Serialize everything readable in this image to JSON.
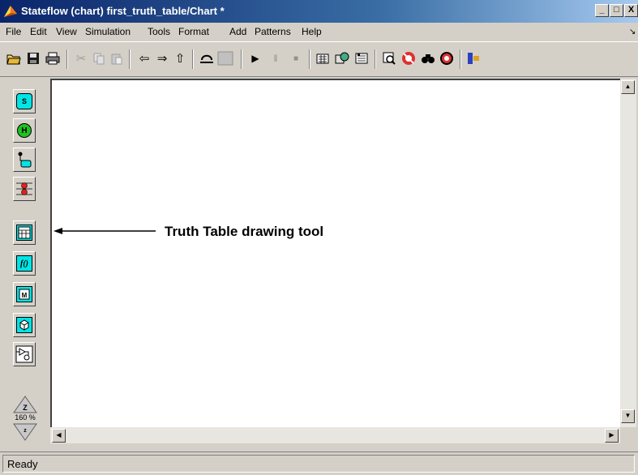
{
  "window": {
    "title": "Stateflow (chart) first_truth_table/Chart *",
    "controls": [
      "_",
      "□",
      "X"
    ]
  },
  "menu": {
    "items": [
      "File",
      "Edit",
      "View",
      "Simulation",
      "Tools",
      "Format",
      "Add",
      "Patterns",
      "Help"
    ]
  },
  "toolbar": {
    "icons": [
      "open-icon",
      "save-icon",
      "print-icon",
      "cut-icon",
      "copy-icon",
      "paste-icon",
      "back-icon",
      "forward-icon",
      "up-icon",
      "undo-icon",
      "redo-icon",
      "start-icon",
      "pause-icon",
      "stop-icon",
      "build-icon",
      "rebuild-icon",
      "parse-icon",
      "explorer-icon",
      "debug-icon",
      "find-icon",
      "target-icon",
      "model-icon"
    ]
  },
  "palette": {
    "tools": [
      {
        "name": "state-tool",
        "glyph": "S"
      },
      {
        "name": "history-junction-tool",
        "glyph": "H"
      },
      {
        "name": "default-transition-tool",
        "glyph": ""
      },
      {
        "name": "connective-junction-tool",
        "glyph": ""
      },
      {
        "name": "truth-table-tool",
        "glyph": "TT"
      },
      {
        "name": "graphical-function-tool",
        "glyph": "f()"
      },
      {
        "name": "embedded-matlab-tool",
        "glyph": "M"
      },
      {
        "name": "box-tool",
        "glyph": "B"
      },
      {
        "name": "simulink-function-tool",
        "glyph": ""
      }
    ],
    "zoom_level": "160 %"
  },
  "annotation": {
    "text": "Truth Table drawing tool"
  },
  "status": {
    "text": "Ready"
  }
}
